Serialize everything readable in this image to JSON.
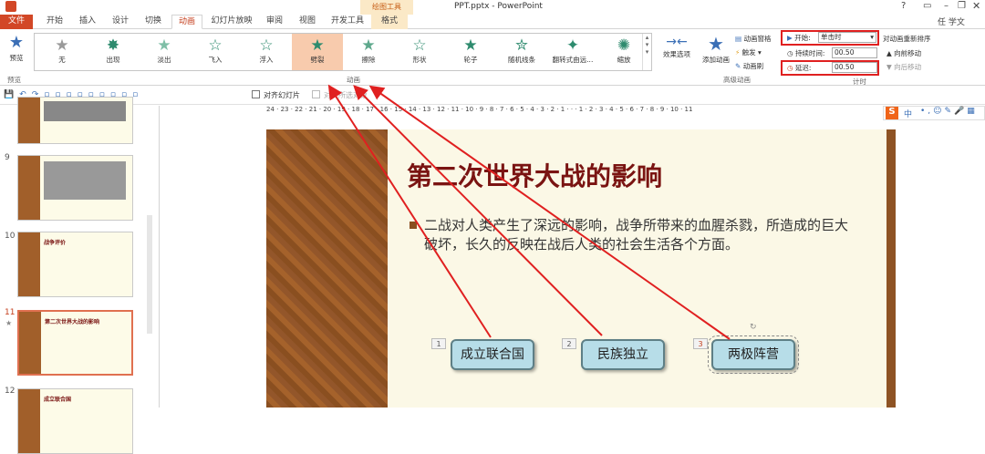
{
  "window": {
    "title": "PPT.pptx - PowerPoint",
    "context_tab_group": "绘图工具",
    "user": "任 学文"
  },
  "tabs": [
    {
      "label": "文件"
    },
    {
      "label": "开始"
    },
    {
      "label": "插入"
    },
    {
      "label": "设计"
    },
    {
      "label": "切换"
    },
    {
      "label": "动画"
    },
    {
      "label": "幻灯片放映"
    },
    {
      "label": "审阅"
    },
    {
      "label": "视图"
    },
    {
      "label": "开发工具"
    },
    {
      "label": "格式"
    }
  ],
  "ribbon": {
    "preview": {
      "label": "预览",
      "group": "预览"
    },
    "effects": [
      {
        "label": "无"
      },
      {
        "label": "出现"
      },
      {
        "label": "淡出"
      },
      {
        "label": "飞入"
      },
      {
        "label": "浮入"
      },
      {
        "label": "劈裂"
      },
      {
        "label": "擦除"
      },
      {
        "label": "形状"
      },
      {
        "label": "轮子"
      },
      {
        "label": "随机线条"
      },
      {
        "label": "翻转式由远..."
      },
      {
        "label": "缩放"
      }
    ],
    "animation_group": "动画",
    "effect_options": "效果选项",
    "add_animation": "添加动画",
    "animation_pane": "动画窗格",
    "trigger": "触发",
    "animation_painter": "动画刷",
    "advanced_group": "高级动画",
    "start_label": "开始:",
    "start_value": "单击时",
    "duration_label": "持续时间:",
    "duration_value": "00.50",
    "delay_label": "延迟:",
    "delay_value": "00.50",
    "reorder_title": "对动画重新排序",
    "move_earlier": "向前移动",
    "move_later": "向后移动",
    "timing_group": "计时"
  },
  "qat": {
    "align_to_slide": "对齐幻灯片",
    "align_selected": "对齐所选对象"
  },
  "thumbnails": [
    {
      "num": "9"
    },
    {
      "num": "10",
      "title": "战争评价"
    },
    {
      "num": "11",
      "title": "第二次世界大战的影响"
    },
    {
      "num": "12",
      "title": "成立联合国"
    }
  ],
  "ruler_text": "24 · 23 · 22 · 21 · 20 · 19 · 18 · 17 · 16 · 15 · 14 · 13 · 12 · 11 · 10 · 9 · 8 · 7 · 6 · 5 · 4 · 3 · 2 · 1 · · · 1 · 2 · 3 · 4 · 5 · 6 · 7 · 8 · 9 · 10 · 11",
  "slide": {
    "title": "第二次世界大战的影响",
    "body": "二战对人类产生了深远的影响，战争所带来的血腥杀戮，所造成的巨大破坏，长久的反映在战后人类的社会生活各个方面。",
    "boxes": [
      {
        "tag": "1",
        "label": "成立联合国"
      },
      {
        "tag": "2",
        "label": "民族独立"
      },
      {
        "tag": "3",
        "label": "两极阵营"
      }
    ]
  },
  "ime_label": "中"
}
